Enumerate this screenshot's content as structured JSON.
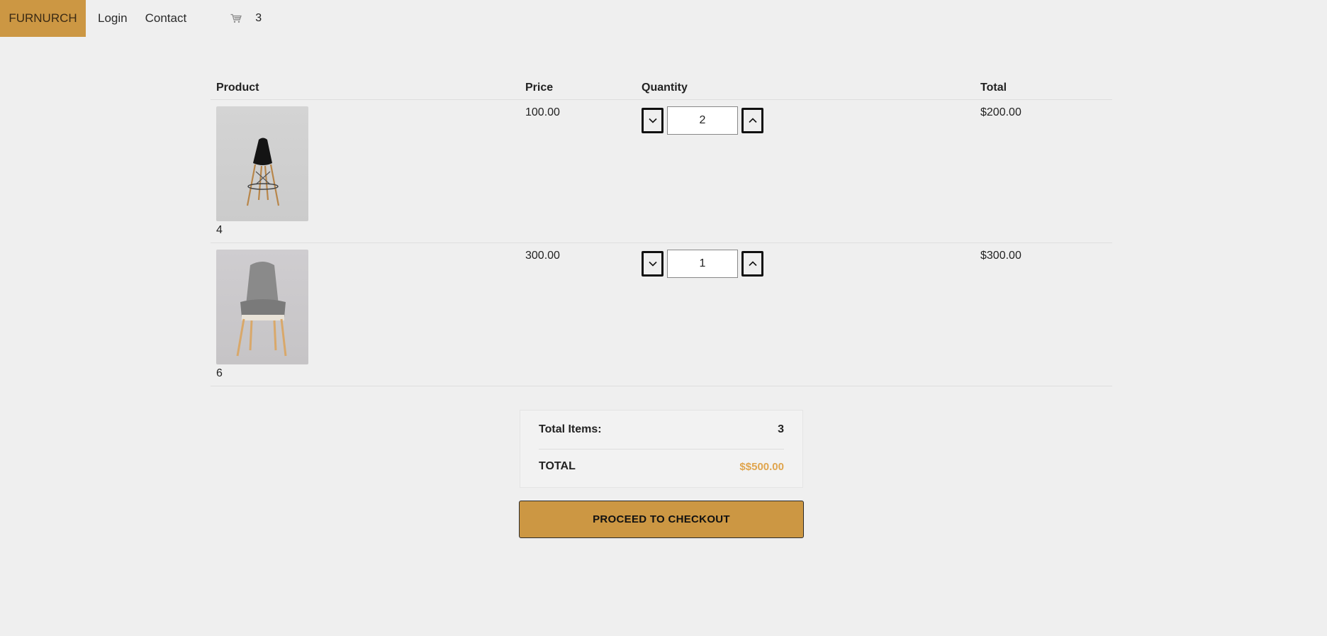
{
  "nav": {
    "brand": "FURNURCH",
    "login": "Login",
    "contact": "Contact",
    "cart_icon": "shopping-cart-icon",
    "cart_count": "3",
    "brand_color": "#cc9743"
  },
  "table": {
    "headers": {
      "product": "Product",
      "price": "Price",
      "quantity": "Quantity",
      "total": "Total"
    },
    "rows": [
      {
        "image": "black-bar-stool",
        "product_id": "4",
        "price": "100.00",
        "quantity": "2",
        "total": "$200.00"
      },
      {
        "image": "grey-upholstered-chair",
        "product_id": "6",
        "price": "300.00",
        "quantity": "1",
        "total": "$300.00"
      }
    ]
  },
  "summary": {
    "items_label": "Total Items:",
    "items_value": "3",
    "total_label": "TOTAL",
    "total_value": "$$500.00",
    "total_color": "#e0a54e"
  },
  "checkout": {
    "label": "PROCEED TO CHECKOUT"
  }
}
